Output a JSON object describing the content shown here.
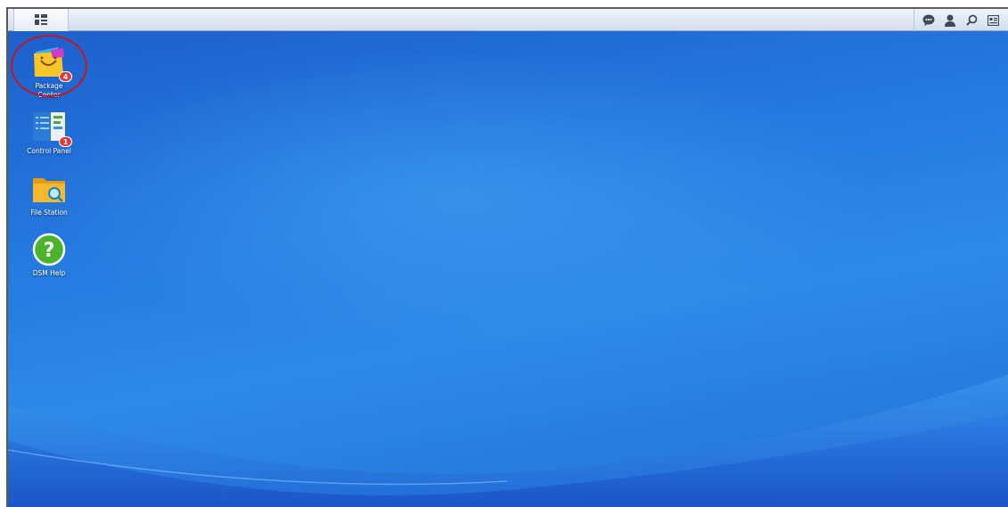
{
  "taskbar": {
    "main_menu_icon": "grid-icon",
    "tray": [
      {
        "name": "notifications-chat-icon"
      },
      {
        "name": "user-icon"
      },
      {
        "name": "search-icon"
      },
      {
        "name": "widgets-icon"
      }
    ]
  },
  "desktop": {
    "items": [
      {
        "label_line1": "Package",
        "label_line2": "Center",
        "icon": "package-center-icon",
        "badge": "4"
      },
      {
        "label": "Control Panel",
        "icon": "control-panel-icon",
        "badge": "1"
      },
      {
        "label": "File Station",
        "icon": "folder-search-icon"
      },
      {
        "label": "DSM Help",
        "icon": "help-icon"
      }
    ]
  },
  "colors": {
    "desktop_blue": "#2579df",
    "badge_red": "#e23a3a",
    "highlight_red": "#c4161c",
    "help_green": "#4bb32b",
    "folder_yellow": "#f7b82b"
  }
}
